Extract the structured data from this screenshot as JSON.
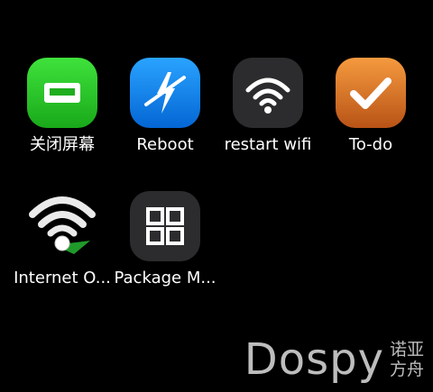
{
  "apps": [
    {
      "label": "关闭屏幕",
      "icon": "screen-off-icon",
      "color": "#22c21f"
    },
    {
      "label": "Reboot",
      "icon": "reboot-icon",
      "color": "#0b7be8"
    },
    {
      "label": "restart wifi",
      "icon": "wifi-icon",
      "color": "#2c2c2e"
    },
    {
      "label": "To-do",
      "icon": "checkmark-icon",
      "color": "#e07a2a"
    },
    {
      "label": "Internet O...",
      "icon": "internet-wifi-icon",
      "color": "#ffffff"
    },
    {
      "label": "Package M...",
      "icon": "grid-icon",
      "color": "#2c2c2e"
    }
  ],
  "watermark": {
    "main": "Dospy",
    "line1": "诺亚",
    "line2": "方舟"
  }
}
